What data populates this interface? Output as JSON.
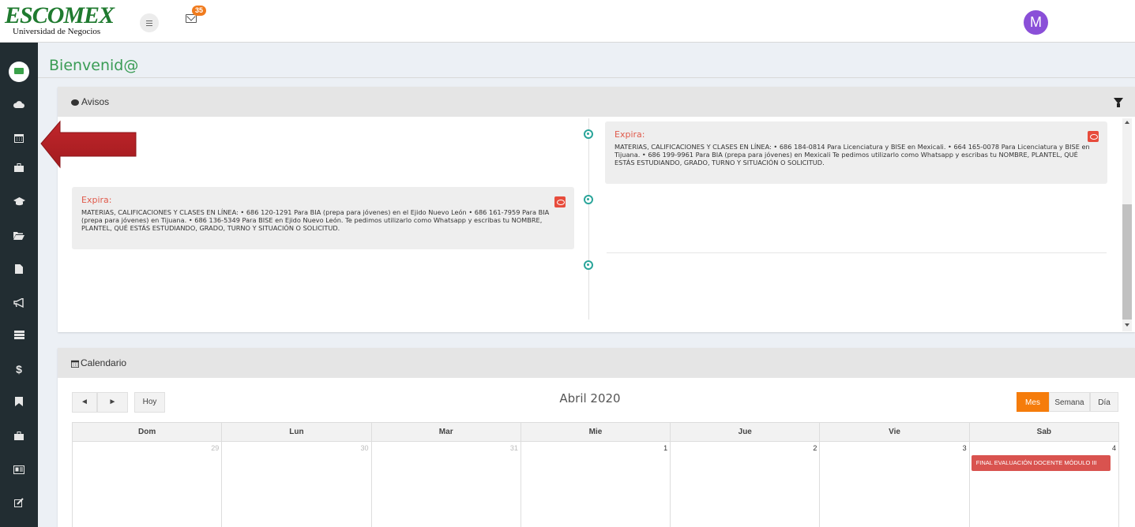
{
  "header": {
    "logo_title": "ESCOMEX",
    "logo_subtitle": "Universidad de Negocios",
    "mail_count": "35",
    "avatar_initial": "M"
  },
  "sidebar": {
    "items": [
      {
        "icon": "desktop-icon"
      },
      {
        "icon": "cloud-icon"
      },
      {
        "icon": "calendar-icon"
      },
      {
        "icon": "briefcase-icon"
      },
      {
        "icon": "graduation-cap-icon"
      },
      {
        "icon": "folder-open-icon"
      },
      {
        "icon": "file-icon"
      },
      {
        "icon": "bullhorn-icon"
      },
      {
        "icon": "list-icon"
      },
      {
        "icon": "dollar-icon"
      },
      {
        "icon": "bookmark-icon"
      },
      {
        "icon": "briefcase-icon"
      },
      {
        "icon": "id-card-icon"
      },
      {
        "icon": "edit-icon"
      }
    ]
  },
  "page": {
    "title": "Bienvenid@"
  },
  "avisos": {
    "header": "Avisos",
    "items": [
      {
        "side": "right",
        "label": "Expira:",
        "text": "MATERIAS, CALIFICACIONES Y CLASES EN LÍNEA: • 686 184-0814 Para Licenciatura y BISE en Mexicali. • 664 165-0078 Para Licenciatura y BISE en Tijuana. • 686 199-9961 Para BIA (prepa para jóvenes) en Mexicali Te pedimos utilizarlo como Whatsapp y escribas tu NOMBRE, PLANTEL, QUÉ ESTÁS ESTUDIANDO, GRADO, TURNO Y SITUACIÓN O SOLICITUD."
      },
      {
        "side": "left",
        "label": "Expira:",
        "text": "MATERIAS, CALIFICACIONES Y CLASES EN LÍNEA: • 686 120-1291 Para BIA (prepa para jóvenes) en el Ejido Nuevo León • 686 161-7959 Para BIA (prepa para jóvenes) en Tijuana. • 686 136-5349 Para BISE en Ejido Nuevo León. Te pedimos utilizarlo como Whatsapp y escribas tu NOMBRE, PLANTEL, QUÉ ESTÁS ESTUDIANDO, GRADO, TURNO Y SITUACIÓN O SOLICITUD."
      }
    ]
  },
  "calendar": {
    "header": "Calendario",
    "prev": "◄",
    "next": "►",
    "today": "Hoy",
    "month_title": "Abril 2020",
    "views": [
      "Mes",
      "Semana",
      "Día"
    ],
    "active_view": "Mes",
    "weekdays": [
      "Dom",
      "Lun",
      "Mar",
      "Mie",
      "Jue",
      "Vie",
      "Sab"
    ],
    "week1": [
      {
        "day": "29",
        "other_month": true
      },
      {
        "day": "30",
        "other_month": true
      },
      {
        "day": "31",
        "other_month": true
      },
      {
        "day": "1",
        "other_month": false
      },
      {
        "day": "2",
        "other_month": false
      },
      {
        "day": "3",
        "other_month": false
      },
      {
        "day": "4",
        "other_month": false,
        "event": "FINAL EVALUACIÓN DOCENTE MÓDULO III"
      }
    ]
  },
  "colors": {
    "brand_green": "#1f7a2f",
    "accent_orange": "#f57c0b",
    "event_red": "#d9534f",
    "timeline_teal": "#2aa59a"
  }
}
